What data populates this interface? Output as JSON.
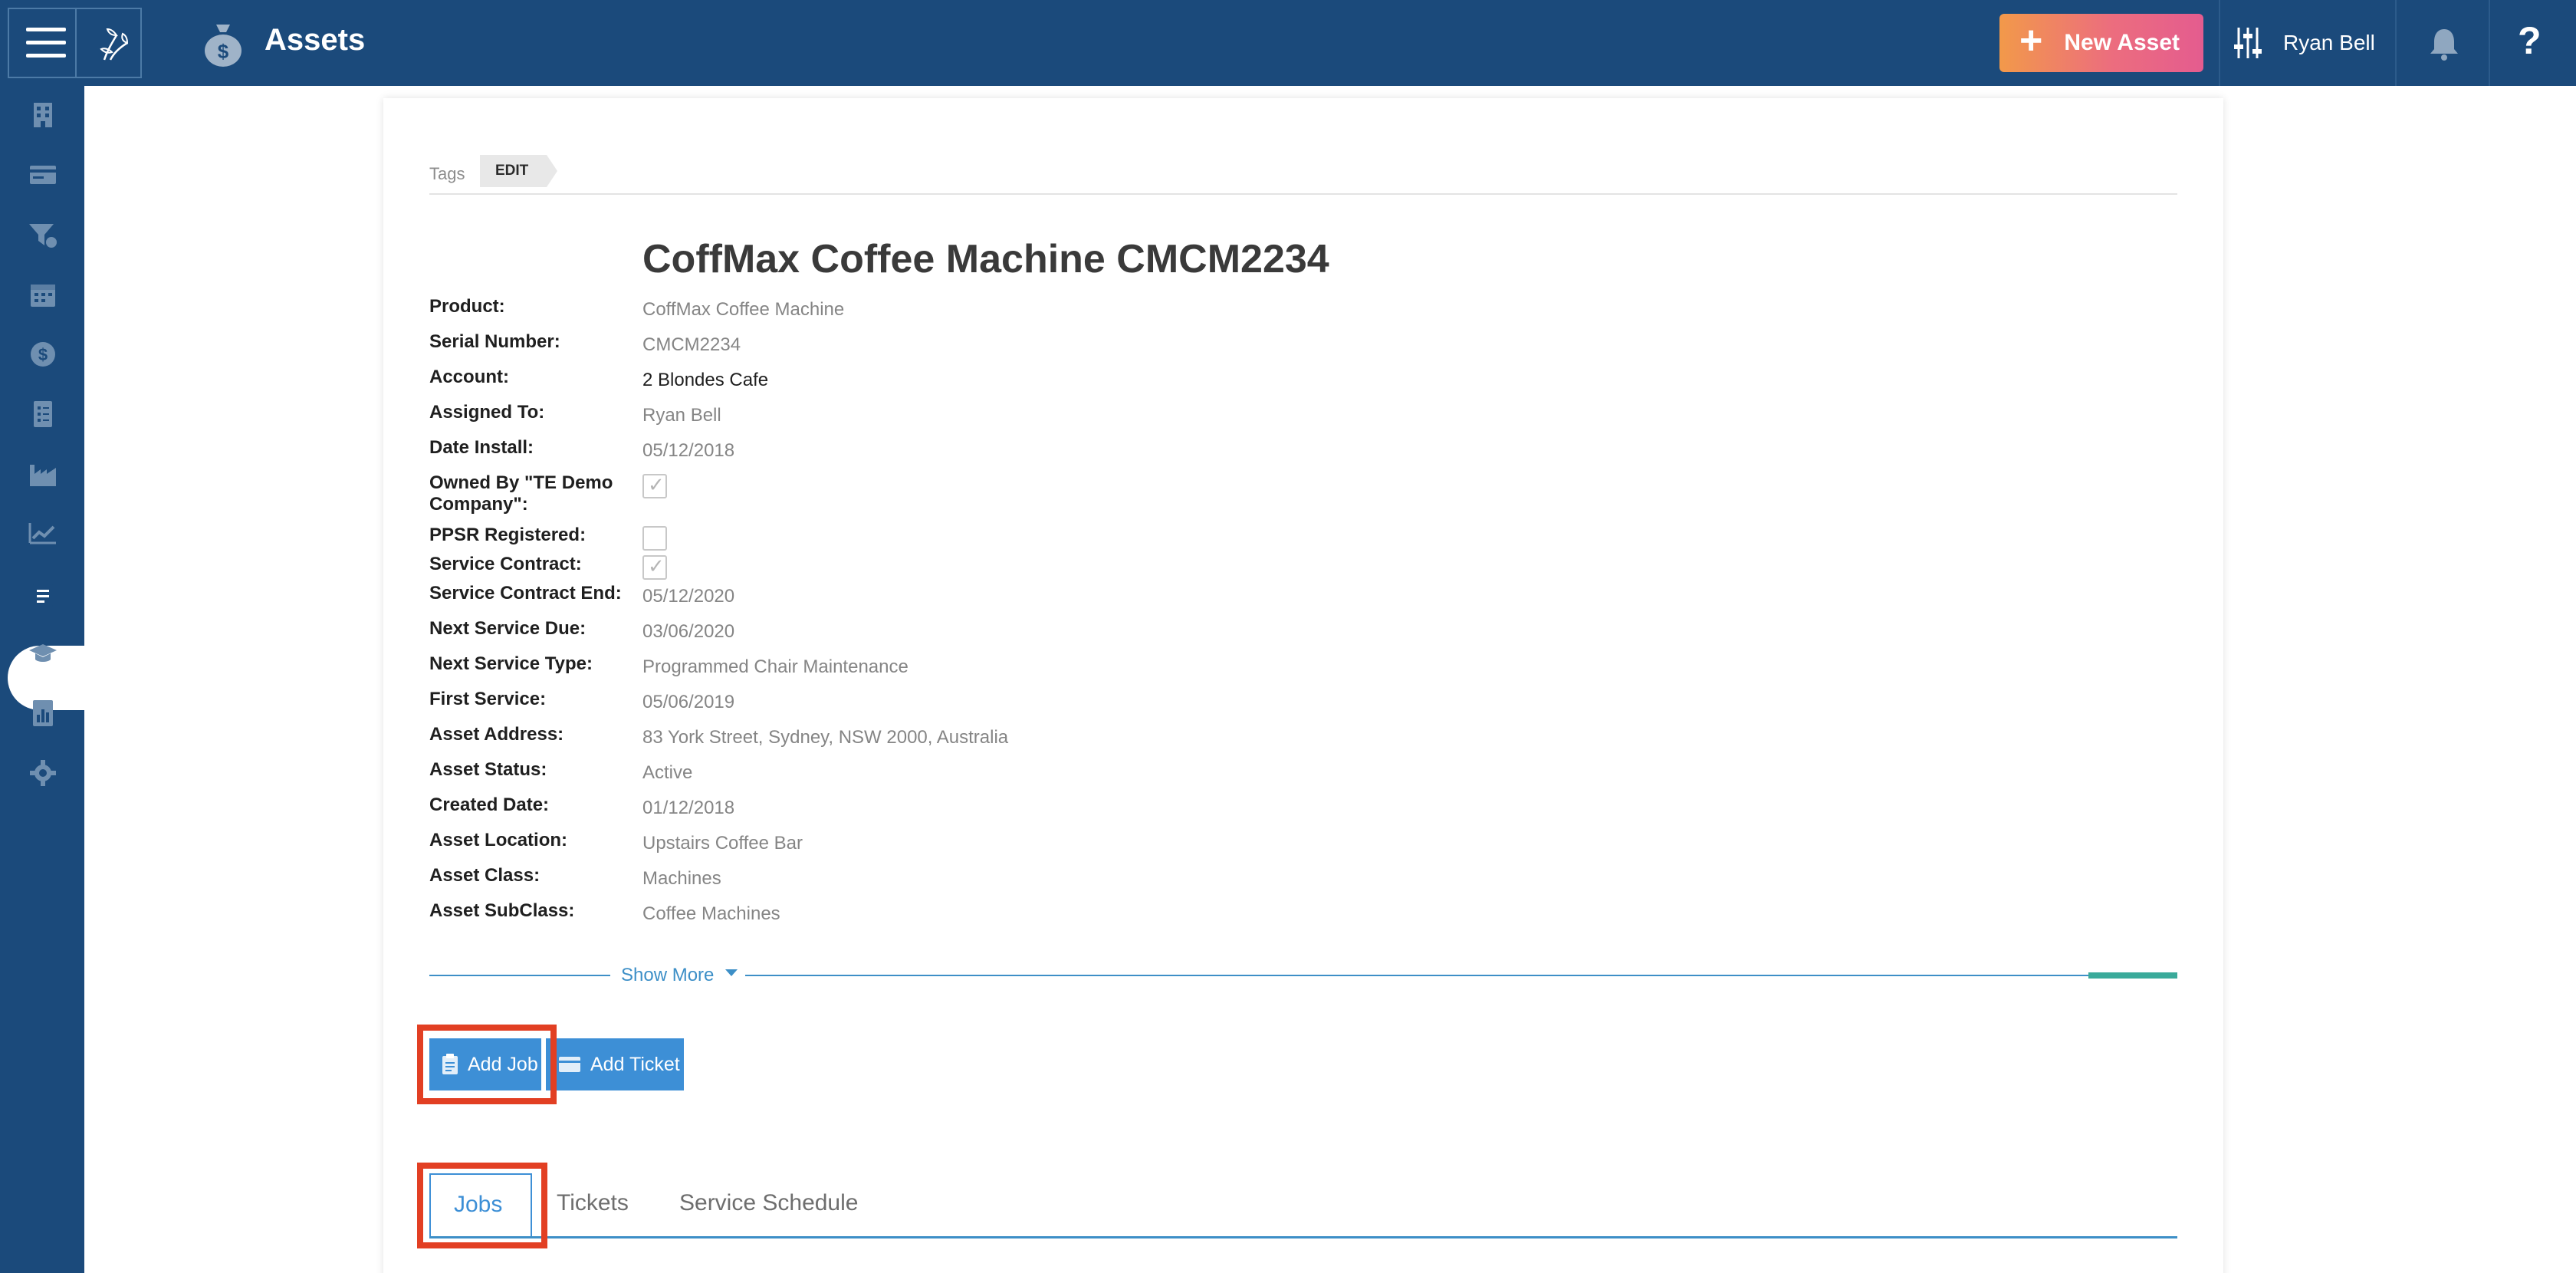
{
  "header": {
    "title": "Assets",
    "new_asset_label": "New Asset",
    "user_name": "Ryan Bell",
    "help_label": "?"
  },
  "sidebar": {
    "items": [
      {
        "icon": "building-icon"
      },
      {
        "icon": "card-icon"
      },
      {
        "icon": "funnel-icon"
      },
      {
        "icon": "calendar-icon"
      },
      {
        "icon": "dollar-icon"
      },
      {
        "icon": "checklist-icon"
      },
      {
        "icon": "factory-icon"
      },
      {
        "icon": "trend-chart-icon"
      },
      {
        "icon": "clipboard-icon",
        "active": true
      },
      {
        "icon": "graduation-cap-icon"
      },
      {
        "icon": "report-icon"
      },
      {
        "icon": "settings-gear-icon"
      }
    ]
  },
  "tags": {
    "label": "Tags",
    "edit_label": "EDIT"
  },
  "asset": {
    "title": "CoffMax Coffee Machine CMCM2234",
    "fields": {
      "product": {
        "label": "Product:",
        "value": "CoffMax Coffee Machine"
      },
      "serial": {
        "label": "Serial Number:",
        "value": "CMCM2234"
      },
      "account": {
        "label": "Account:",
        "value": "2 Blondes Cafe"
      },
      "assigned": {
        "label": "Assigned To:",
        "value": "Ryan Bell"
      },
      "date_install": {
        "label": "Date Install:",
        "value": "05/12/2018"
      },
      "owned_by": {
        "label": "Owned By \"TE Demo Company\":",
        "checked": true
      },
      "ppsr": {
        "label": "PPSR Registered:",
        "checked": false
      },
      "service_contract": {
        "label": "Service Contract:",
        "checked": true
      },
      "contract_end": {
        "label": "Service Contract End:",
        "value": "05/12/2020"
      },
      "next_due": {
        "label": "Next Service Due:",
        "value": "03/06/2020"
      },
      "next_type": {
        "label": "Next Service Type:",
        "value": "Programmed Chair Maintenance"
      },
      "first_service": {
        "label": "First Service:",
        "value": "05/06/2019"
      },
      "address": {
        "label": "Asset Address:",
        "value": "83 York Street, Sydney, NSW 2000, Australia"
      },
      "status": {
        "label": "Asset Status:",
        "value": "Active"
      },
      "created": {
        "label": "Created Date:",
        "value": "01/12/2018"
      },
      "location": {
        "label": "Asset Location:",
        "value": "Upstairs Coffee Bar"
      },
      "class": {
        "label": "Asset Class:",
        "value": "Machines"
      },
      "subclass": {
        "label": "Asset SubClass:",
        "value": "Coffee Machines"
      }
    }
  },
  "show_more_label": "Show More",
  "actions": {
    "add_job": "Add Job",
    "add_ticket": "Add Ticket"
  },
  "tabs": [
    "Jobs",
    "Tickets",
    "Service Schedule"
  ],
  "colors": {
    "nav": "#1b4a7b",
    "primary": "#3d8fd6",
    "highlight": "#e23f23",
    "accent": "#3aaa9a"
  }
}
